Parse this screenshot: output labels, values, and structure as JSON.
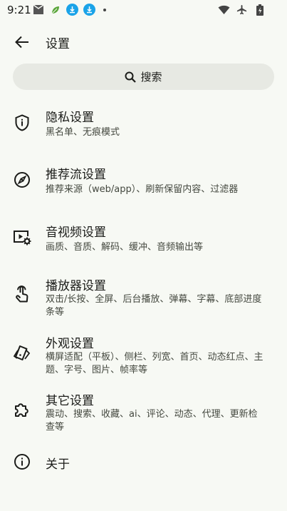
{
  "status_bar": {
    "time": "9:21",
    "icons_left": [
      "mail-icon",
      "leaf-icon",
      "download-badge-icon",
      "download-badge-icon",
      "notification-dot"
    ],
    "icons_right": [
      "wifi-icon",
      "airplane-icon",
      "battery-charging-icon"
    ]
  },
  "appbar": {
    "title": "设置"
  },
  "search": {
    "label": "搜索"
  },
  "items": [
    {
      "title": "隐私设置",
      "subtitle": "黑名单、无痕模式",
      "icon": "shield-info-icon"
    },
    {
      "title": "推荐流设置",
      "subtitle": "推荐来源（web/app）、刷新保留内容、过滤器",
      "icon": "compass-icon"
    },
    {
      "title": "音视频设置",
      "subtitle": "画质、音质、解码、缓冲、音频输出等",
      "icon": "video-settings-icon"
    },
    {
      "title": "播放器设置",
      "subtitle": "双击/长按、全屏、后台播放、弹幕、字幕、底部进度条等",
      "icon": "touch-icon"
    },
    {
      "title": "外观设置",
      "subtitle": "横屏适配（平板）、侧栏、列宽、首页、动态红点、主题、字号、图片、帧率等",
      "icon": "palette-icon"
    },
    {
      "title": "其它设置",
      "subtitle": "震动、搜索、收藏、ai、评论、动态、代理、更新检查等",
      "icon": "puzzle-icon"
    },
    {
      "title": "关于",
      "subtitle": "",
      "icon": "info-icon"
    }
  ],
  "colors": {
    "background": "#f7f9f4",
    "search_bg": "#e7e9e3",
    "text": "#1b1c19",
    "subtext": "#44483f",
    "download_badge": "#1aa3e8"
  }
}
